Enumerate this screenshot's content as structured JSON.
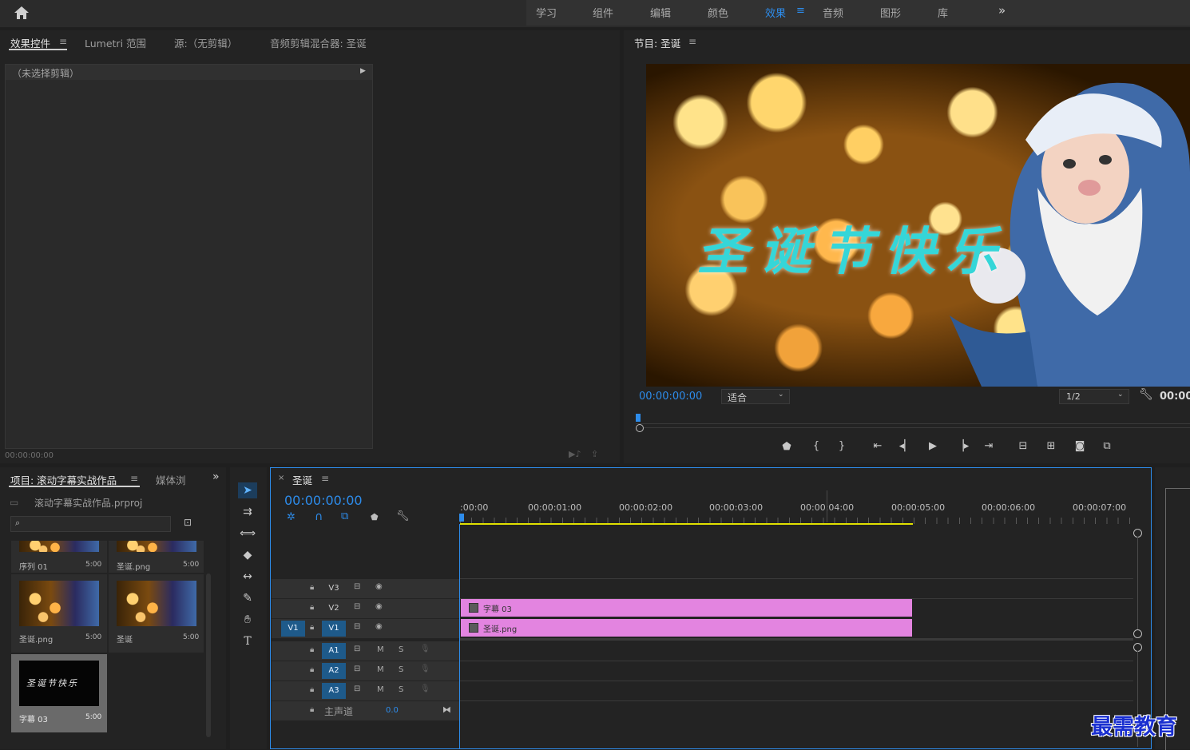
{
  "workspaces": [
    "学习",
    "组件",
    "编辑",
    "颜色",
    "效果",
    "音频",
    "图形",
    "库"
  ],
  "active_workspace": "效果",
  "more_label": "»",
  "source_panel": {
    "tabs": [
      "效果控件",
      "Lumetri 范围",
      "源:（无剪辑）",
      "音频剪辑混合器: 圣诞"
    ],
    "no_clip_label": "（未选择剪辑）",
    "timecode": "00:00:00:00"
  },
  "program_monitor": {
    "title": "节目: 圣诞",
    "overlay_text": "圣诞节快乐",
    "timecode": "00:00:00:00",
    "zoom": "适合",
    "resolution": "1/2",
    "duration_partial": "00:00"
  },
  "project_panel": {
    "tabs": [
      "项目: 滚动字幕实战作品",
      "媒体浏"
    ],
    "project_file": "滚动字幕实战作品.prproj",
    "items": [
      {
        "name": "序列 01",
        "duration": "5:00"
      },
      {
        "name": "圣诞.png",
        "duration": "5:00"
      },
      {
        "name": "圣诞.png",
        "duration": "5:00"
      },
      {
        "name": "圣诞",
        "duration": "5:00"
      },
      {
        "name": "字幕 03",
        "duration": "5:00"
      }
    ],
    "caption_preview": "圣诞节快乐"
  },
  "timeline": {
    "sequence_name": "圣诞",
    "timecode": "00:00:00:00",
    "ruler": [
      ":00:00",
      "00:00:01:00",
      "00:00:02:00",
      "00:00:03:00",
      "00:00:04:00",
      "00:00:05:00",
      "00:00:06:00",
      "00:00:07:00"
    ],
    "video_tracks": [
      "V3",
      "V2",
      "V1"
    ],
    "audio_tracks": [
      "A1",
      "A2",
      "A3"
    ],
    "source_patch": "V1",
    "mute_label": "M",
    "solo_label": "S",
    "master_label": "主声道",
    "master_value": "0.0",
    "clips": [
      {
        "track": "V2",
        "name": "字幕 03"
      },
      {
        "track": "V1",
        "name": "圣诞.png"
      }
    ]
  },
  "watermark": "最需教育",
  "colors": {
    "accent": "#2d8ceb",
    "clip": "#e384e0",
    "work_area": "#e0e000",
    "caption": "#35d6d8"
  }
}
